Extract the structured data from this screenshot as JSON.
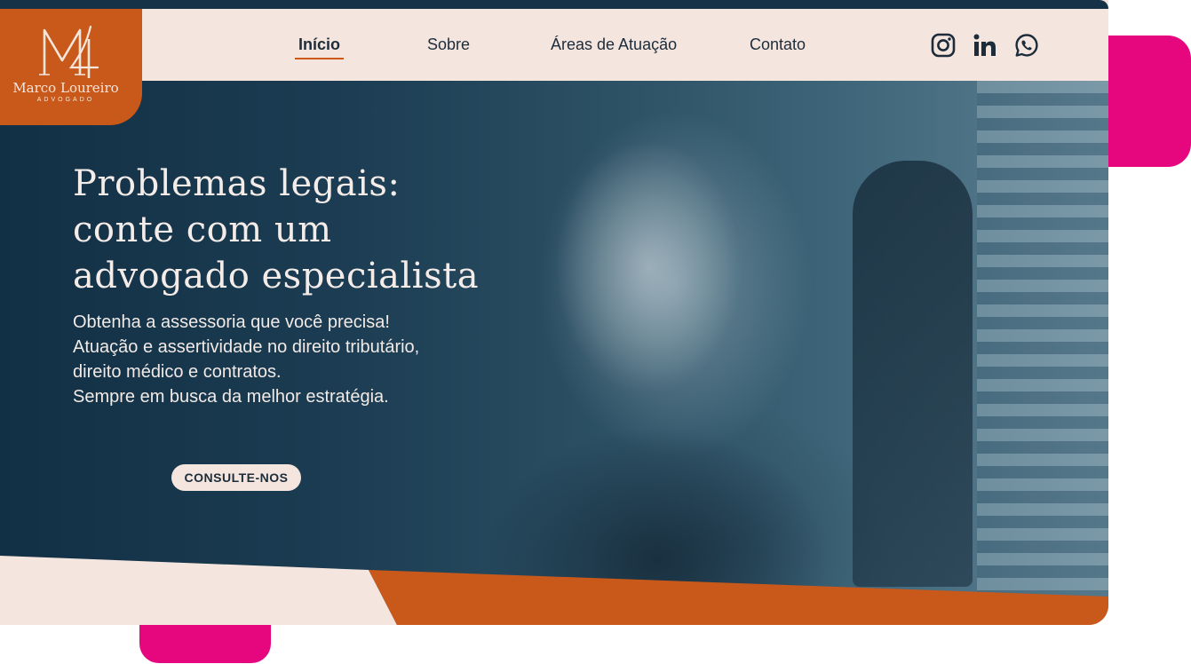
{
  "logo": {
    "name": "Marco Loureiro",
    "role": "ADVOGADO",
    "monogram_icon": "ml-monogram-icon"
  },
  "nav": {
    "items": [
      {
        "label": "Início",
        "active": true
      },
      {
        "label": "Sobre",
        "active": false
      },
      {
        "label": "Áreas de Atuação",
        "active": false
      },
      {
        "label": "Contato",
        "active": false
      }
    ],
    "social": [
      {
        "icon": "instagram-icon"
      },
      {
        "icon": "linkedin-icon"
      },
      {
        "icon": "whatsapp-icon"
      }
    ]
  },
  "hero": {
    "title_lines": [
      "Problemas legais:",
      "conte com um",
      "advogado especialista"
    ],
    "subtitle_lines": [
      "Obtenha a assessoria que você precisa!",
      "Atuação e assertividade no direito tributário,",
      "direito médico e contratos.",
      "Sempre em busca da melhor estratégia."
    ],
    "cta_label": "CONSULTE-NOS"
  },
  "colors": {
    "navy": "#153246",
    "orange": "#c9591a",
    "cream": "#f4e5de",
    "magenta": "#e6077f"
  }
}
